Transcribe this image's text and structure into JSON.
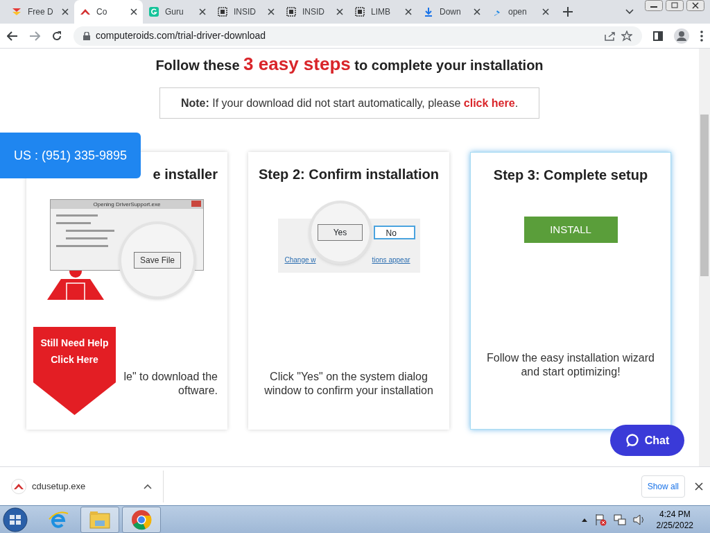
{
  "tabs": [
    {
      "title": "Free D",
      "selected": false
    },
    {
      "title": "Co",
      "selected": true
    },
    {
      "title": "Guru",
      "selected": false
    },
    {
      "title": "INSID",
      "selected": false
    },
    {
      "title": "INSID",
      "selected": false
    },
    {
      "title": "LIMB",
      "selected": false
    },
    {
      "title": "Down",
      "selected": false
    },
    {
      "title": "open",
      "selected": false
    }
  ],
  "address": {
    "url": "computeroids.com/trial-driver-download"
  },
  "page": {
    "heading": {
      "before": "Follow these ",
      "highlight": "3 easy steps",
      "after": " to complete your installation"
    },
    "note": {
      "label": "Note:",
      "text": " If your download did not start automatically, please ",
      "link": "click here",
      "end": "."
    },
    "phone": "US : (951) 335-9895",
    "steps": [
      {
        "kind": "save",
        "title": "e installer",
        "highlighted": false,
        "description": [
          "le\" to download the",
          "oftware."
        ],
        "dialog": {
          "title": "Opening DriverSupport.exe",
          "button": "Save File"
        }
      },
      {
        "kind": "confirm",
        "title": "Step 2: Confirm installation",
        "highlighted": false,
        "description": [
          "Click \"Yes\" on the system dialog",
          "window to confirm your installation"
        ],
        "dialog": {
          "yes": "Yes",
          "no": "No",
          "link": [
            "Change w",
            "tions appear"
          ]
        }
      },
      {
        "kind": "install",
        "title": "Step 3: Complete setup",
        "highlighted": true,
        "button": "INSTALL",
        "description": [
          "Follow the easy installation wizard",
          "and start optimizing!"
        ]
      }
    ],
    "help": [
      "Still Need Help",
      "Click Here"
    ],
    "chat": "Chat"
  },
  "downloads": {
    "file": "cdusetup.exe",
    "show_all": "Show all"
  },
  "taskbar": {
    "time": "4:24 PM",
    "date": "2/25/2022"
  }
}
